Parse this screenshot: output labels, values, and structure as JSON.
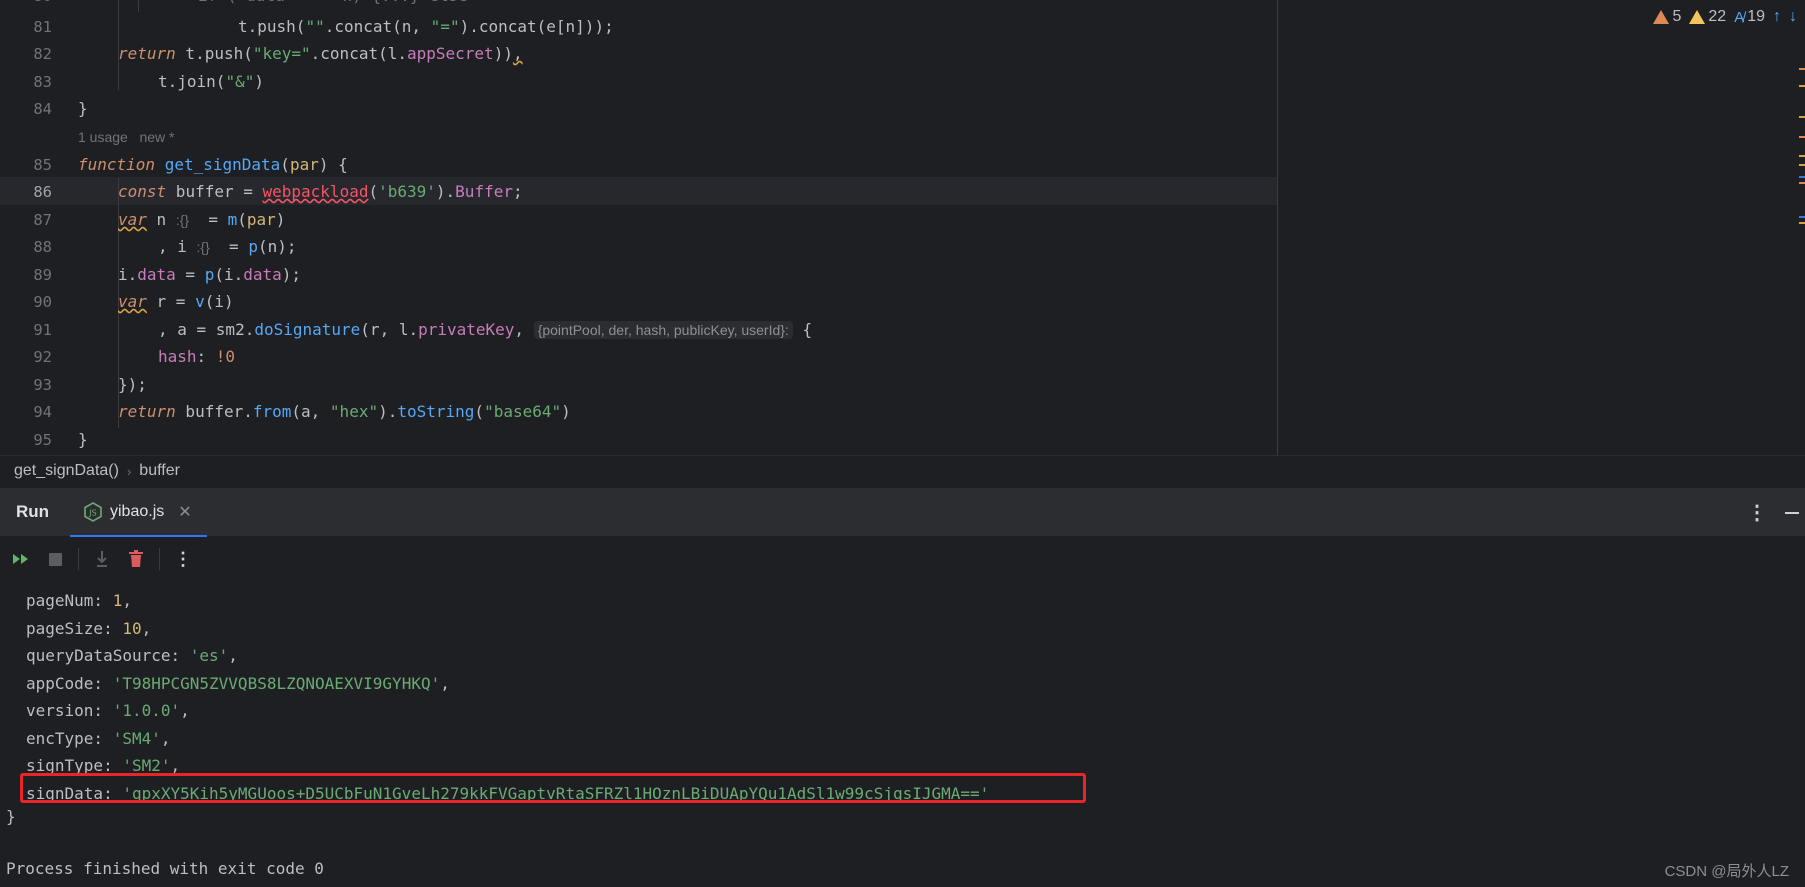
{
  "editor": {
    "line_numbers": [
      "81",
      "82",
      "83",
      "84",
      "85",
      "86",
      "87",
      "88",
      "89",
      "90",
      "91",
      "92",
      "93",
      "94",
      "95"
    ],
    "usage_hint": "1 usage   new *",
    "inlay_param_hint": "{pointPool, der, hash, publicKey, userId}:",
    "inlay_type_hint": ":{}",
    "lines": {
      "l81": {
        "a": "t.push(",
        "b": "\"\"",
        "c": ".concat(n, ",
        "d": "\"=\"",
        "e": ").concat(e[n]));"
      },
      "l82_ret": "return",
      "l82_rest": " t.push(",
      "l82_str": "\"key=\"",
      "l82_b": ".concat(l.",
      "l82_fld": "appSecret",
      "l82_end": "))",
      "l82_tail": ",",
      "l83_a": "t.join(",
      "l83_str": "\"&\"",
      "l83_end": ")",
      "l84": "}",
      "l85_kw": "function",
      "l85_fn": "get_signData",
      "l85_p": "par",
      "l85_end": ") {",
      "l86_kw": "const",
      "l86_a": " buffer = ",
      "l86_fn": "webpackload",
      "l86_str": "'b639'",
      "l86_fld": "Buffer",
      "l87_kw": "var",
      "l87_a": " n ",
      "l87_b": "  = ",
      "l87_fn": "m",
      "l87_p": "par",
      "l88_a": ", i ",
      "l88_b": "  = ",
      "l88_fn": "p",
      "l88_end": "(n);",
      "l89_a": "i.",
      "l89_fld": "data",
      "l89_b": " = ",
      "l89_fn": "p",
      "l89_c": "(i.",
      "l89_end": ");",
      "l90_kw": "var",
      "l90_a": " r = ",
      "l90_fn": "v",
      "l90_end": "(i)",
      "l91_a": ", a = sm2.",
      "l91_fn": "doSignature",
      "l91_b": "(r, l.",
      "l91_fld": "privateKey",
      "l91_c": ", ",
      "l91_end": " {",
      "l92_fld": "hash",
      "l92_a": ": ",
      "l92_num": "!0",
      "l93": "});",
      "l94_kw": "return",
      "l94_a": " buffer.",
      "l94_fn": "from",
      "l94_b": "(a, ",
      "l94_str": "\"hex\"",
      "l94_c": ").",
      "l94_fn2": "toString",
      "l94_d": "(",
      "l94_str2": "\"base64\"",
      "l94_end": ")",
      "l95": "}"
    },
    "inspections": {
      "warnings": "5",
      "weak_warnings": "22",
      "typos": "19"
    }
  },
  "breadcrumb": {
    "items": [
      "get_signData()",
      "buffer"
    ]
  },
  "run_panel": {
    "title": "Run",
    "tab_label": "yibao.js",
    "output": [
      {
        "key": "pageNum: ",
        "val": "1",
        "type": "num",
        "end": ","
      },
      {
        "key": "pageSize: ",
        "val": "10",
        "type": "num",
        "end": ","
      },
      {
        "key": "queryDataSource: ",
        "val": "'es'",
        "type": "str",
        "end": ","
      },
      {
        "key": "appCode: ",
        "val": "'T98HPCGN5ZVVQBS8LZQNOAEXVI9GYHKQ'",
        "type": "str",
        "end": ","
      },
      {
        "key": "version: ",
        "val": "'1.0.0'",
        "type": "str",
        "end": ","
      },
      {
        "key": "encType: ",
        "val": "'SM4'",
        "type": "str",
        "end": ","
      },
      {
        "key": "signType: ",
        "val": "'SM2'",
        "type": "str",
        "end": ","
      },
      {
        "key": "signData: ",
        "val": "'qpxXY5Kih5yMGUoos+D5UCbFuN1GveLh279kkFVGaptvRtaSFRZl1HOznLBiDUApYQu1AdSl1w99cSjqsIJGMA=='",
        "type": "str",
        "end": ""
      }
    ],
    "closing_brace": "}",
    "exit_message": "Process finished with exit code 0"
  },
  "watermark": "CSDN @局外人LZ",
  "colors": {
    "background": "#1e1f22",
    "panel": "#2b2d30",
    "keyword": "#cf8e6d",
    "function": "#56a8f5",
    "string": "#6aab73",
    "field": "#c77dbb",
    "highlight_box": "#e8262a",
    "accent": "#3574f0"
  }
}
